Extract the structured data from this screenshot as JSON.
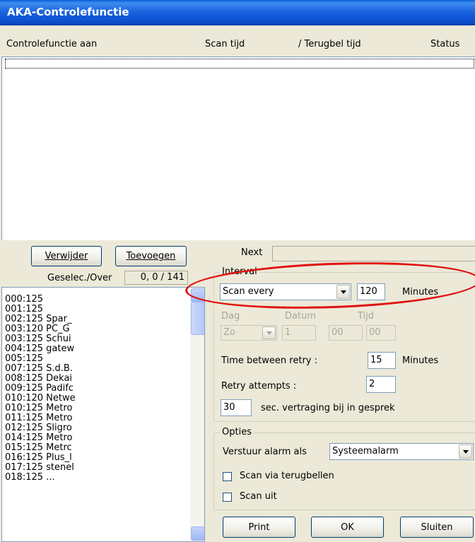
{
  "window": {
    "title": "AKA-Controlefunctie"
  },
  "columns": {
    "c1": "Controlefunctie aan",
    "c2": "Scan tijd",
    "c3": "/  Terugbel tijd",
    "c4": "Status"
  },
  "buttons": {
    "verwijder": "Verwijder",
    "toevoegen": "Toevoegen",
    "print": "Print",
    "ok": "OK",
    "sluiten": "Sluiten"
  },
  "selection": {
    "label": "Geselec./Over",
    "value": "0, 0 / 141"
  },
  "next_label": "Next",
  "next_value": "",
  "stations": [
    "000:125",
    "001:125",
    "002:125  Spar_",
    "003:120  PC_G",
    "003:125  Schui",
    "004:125  gatew",
    "005:125",
    "007:125  S.d.B.",
    "008:125  Dekai",
    "009:125  Padifc",
    "010:120  Netwe",
    "010:125  Metro",
    "011:125  Metro",
    "012:125  Sligro",
    "014:125  Metro",
    "015:125  Metrc",
    "016:125  Plus_l",
    "017:125  stenel",
    "018:125  ..."
  ],
  "interval": {
    "legend": "Interval",
    "mode": "Scan every",
    "value": "120",
    "unit": "Minutes",
    "dag_label": "Dag",
    "datum_label": "Datum",
    "tijd_label": "Tijd",
    "dag_value": "Zo",
    "datum_value": "1",
    "tijd_h": "00",
    "tijd_m": "00",
    "retry_label": "Time between retry :",
    "retry_value": "15",
    "retry_unit": "Minutes",
    "attempts_label": "Retry attempts :",
    "attempts_value": "2",
    "delay_value": "30",
    "delay_label": "sec. vertraging bij in gesprek"
  },
  "opties": {
    "legend": "Opties",
    "alarm_label": "Verstuur alarm als",
    "alarm_value": "Systeemalarm",
    "scan_via_label": "Scan via terugbellen",
    "scan_uit_label": "Scan uit"
  },
  "colors": {
    "titlebar": "#0A4FCF",
    "highlight_oval": "#E01010",
    "window_bg": "#ECE9D8"
  }
}
